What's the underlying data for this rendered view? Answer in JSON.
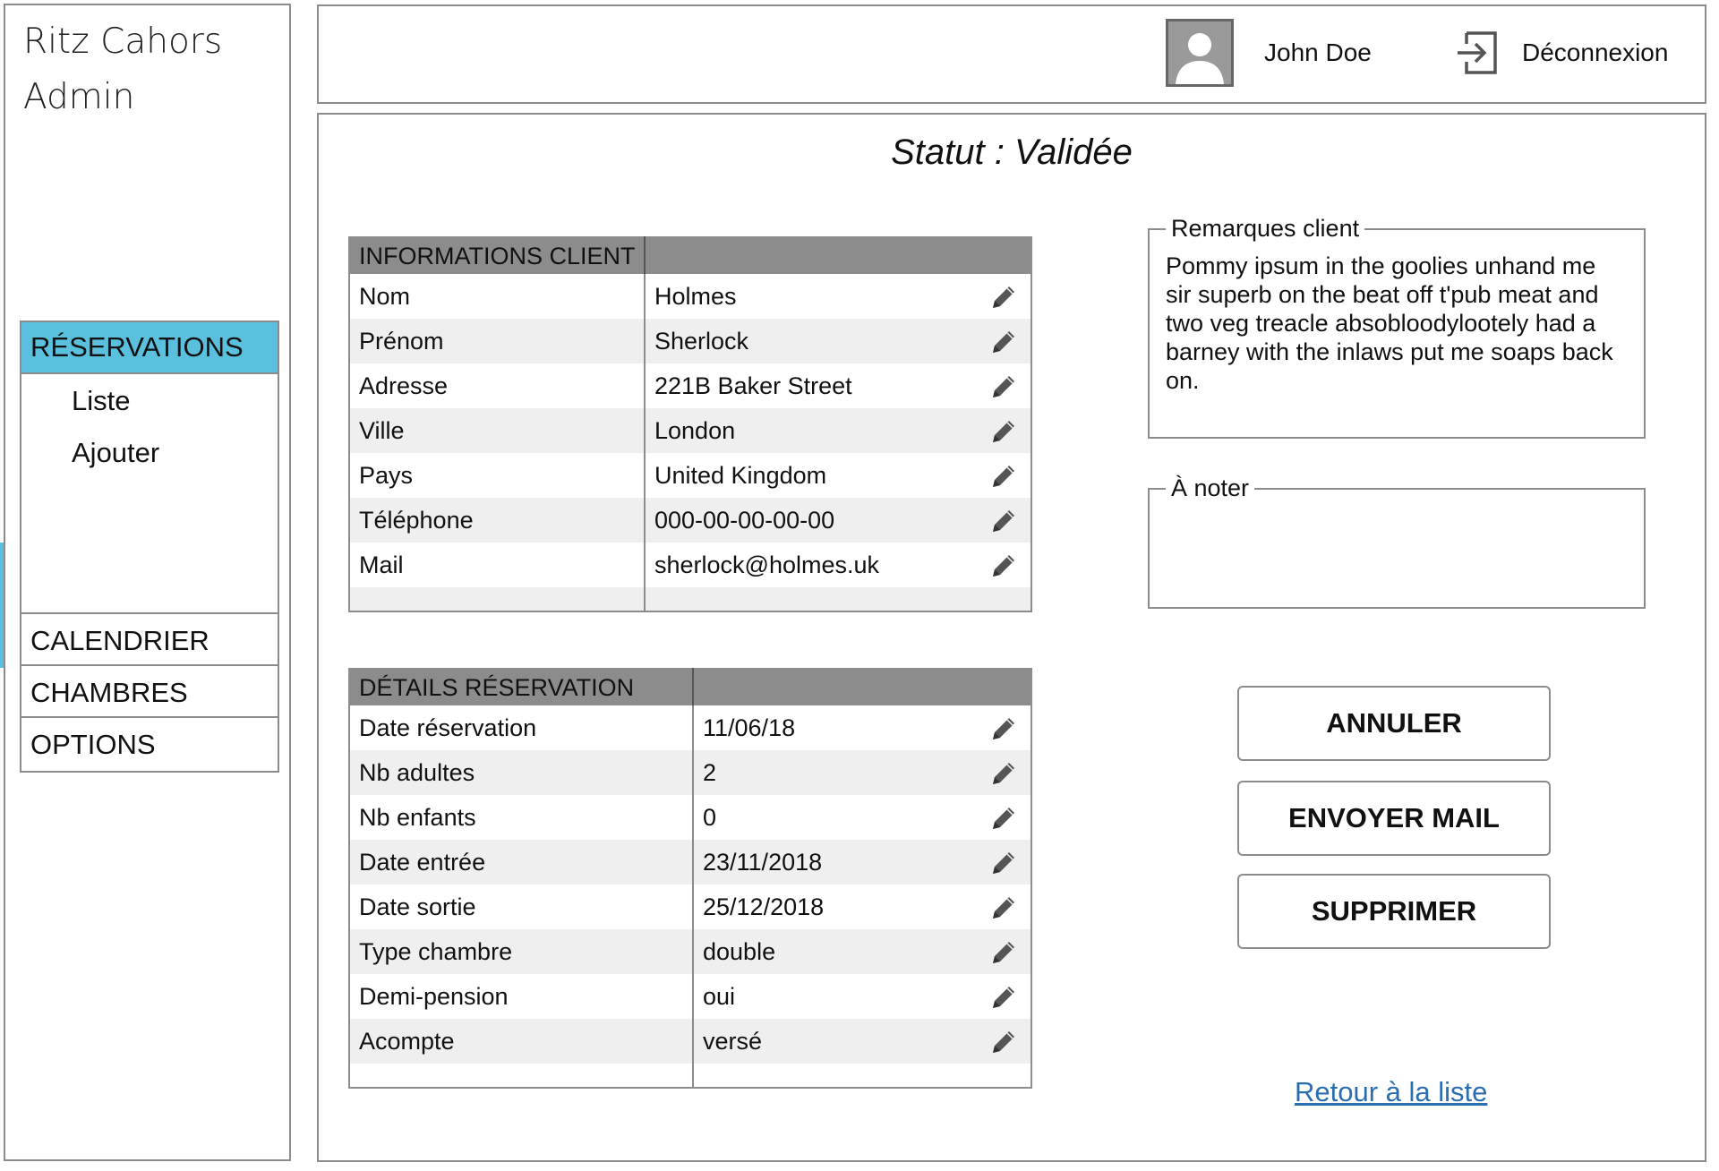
{
  "sidebar": {
    "brand_line1": "Ritz Cahors",
    "brand_line2": "Admin",
    "active_section": "RÉSERVATIONS",
    "sub_items": [
      "Liste",
      "Ajouter"
    ],
    "items": [
      "CALENDRIER",
      "CHAMBRES",
      "OPTIONS"
    ],
    "accent_color": "#5bc0de"
  },
  "header": {
    "user_name": "John Doe",
    "logout_label": "Déconnexion"
  },
  "main": {
    "status": "Statut : Validée",
    "client_table": {
      "header": "INFORMATIONS CLIENT",
      "rows": [
        {
          "label": "Nom",
          "value": "Holmes"
        },
        {
          "label": "Prénom",
          "value": "Sherlock"
        },
        {
          "label": "Adresse",
          "value": "221B Baker Street"
        },
        {
          "label": "Ville",
          "value": "London"
        },
        {
          "label": "Pays",
          "value": "United Kingdom"
        },
        {
          "label": "Téléphone",
          "value": "000-00-00-00-00"
        },
        {
          "label": "Mail",
          "value": "sherlock@holmes.uk"
        }
      ]
    },
    "booking_table": {
      "header": "DÉTAILS RÉSERVATION",
      "rows": [
        {
          "label": "Date réservation",
          "value": "11/06/18"
        },
        {
          "label": "Nb adultes",
          "value": "2"
        },
        {
          "label": "Nb enfants",
          "value": "0"
        },
        {
          "label": "Date entrée",
          "value": "23/11/2018"
        },
        {
          "label": "Date sortie",
          "value": "25/12/2018"
        },
        {
          "label": "Type chambre",
          "value": "double"
        },
        {
          "label": "Demi-pension",
          "value": "oui"
        },
        {
          "label": "Acompte",
          "value": "versé"
        }
      ]
    },
    "remarks": {
      "legend": "Remarques client",
      "text": "Pommy ipsum in the goolies unhand me sir superb on the beat off t'pub meat and two veg treacle absobloodylootely had a barney with the inlaws put me soaps back on."
    },
    "notes": {
      "legend": "À noter",
      "text": ""
    },
    "buttons": {
      "cancel": "ANNULER",
      "send_mail": "ENVOYER MAIL",
      "delete": "SUPPRIMER"
    },
    "back_link": "Retour à la liste"
  },
  "icons": {
    "edit": "pencil-icon",
    "logout": "logout-icon",
    "avatar": "user-avatar"
  }
}
